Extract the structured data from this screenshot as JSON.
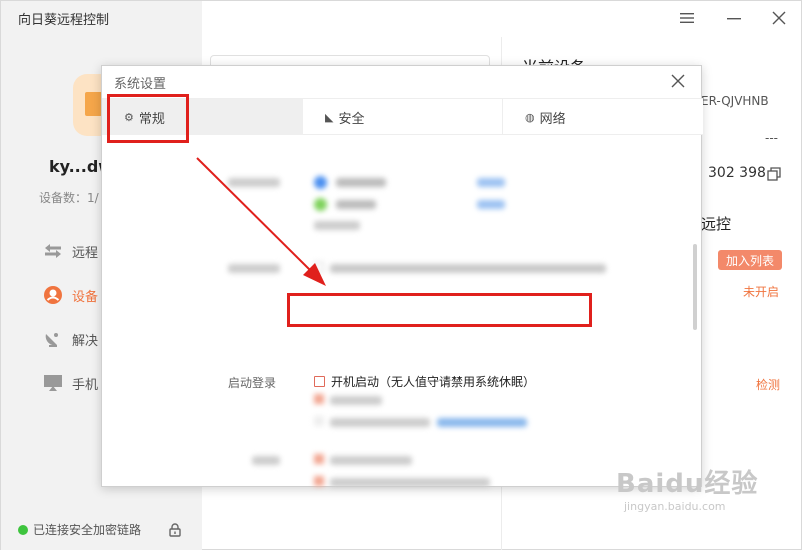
{
  "app": {
    "title": "向日葵远程控制"
  },
  "sidebar": {
    "username": "ky...dw",
    "device_count": "设备数：1/",
    "items": [
      {
        "label": "远程"
      },
      {
        "label": "设备"
      },
      {
        "label": "解决"
      },
      {
        "label": "手机"
      }
    ],
    "status": "已连接安全加密链路"
  },
  "right_panel": {
    "title": "当前设备",
    "device_id": "ER-QJVHNB",
    "dash": "---",
    "code": "302 398",
    "remote": "远控",
    "add_list": "加入列表",
    "not_open": "未开启",
    "check": "检测"
  },
  "dialog": {
    "title": "系统设置",
    "tabs": [
      {
        "label": "常规"
      },
      {
        "label": "安全"
      },
      {
        "label": "网络"
      }
    ],
    "boot_label": "启动登录",
    "boot_text": "开机启动（无人值守请禁用系统休眠）"
  },
  "watermark": {
    "logo": "Baidu经验",
    "sub": "jingyan.baidu.com"
  },
  "colors": {
    "accent": "#f0743f",
    "highlight": "#e0201c",
    "status_ok": "#3ec43e"
  }
}
